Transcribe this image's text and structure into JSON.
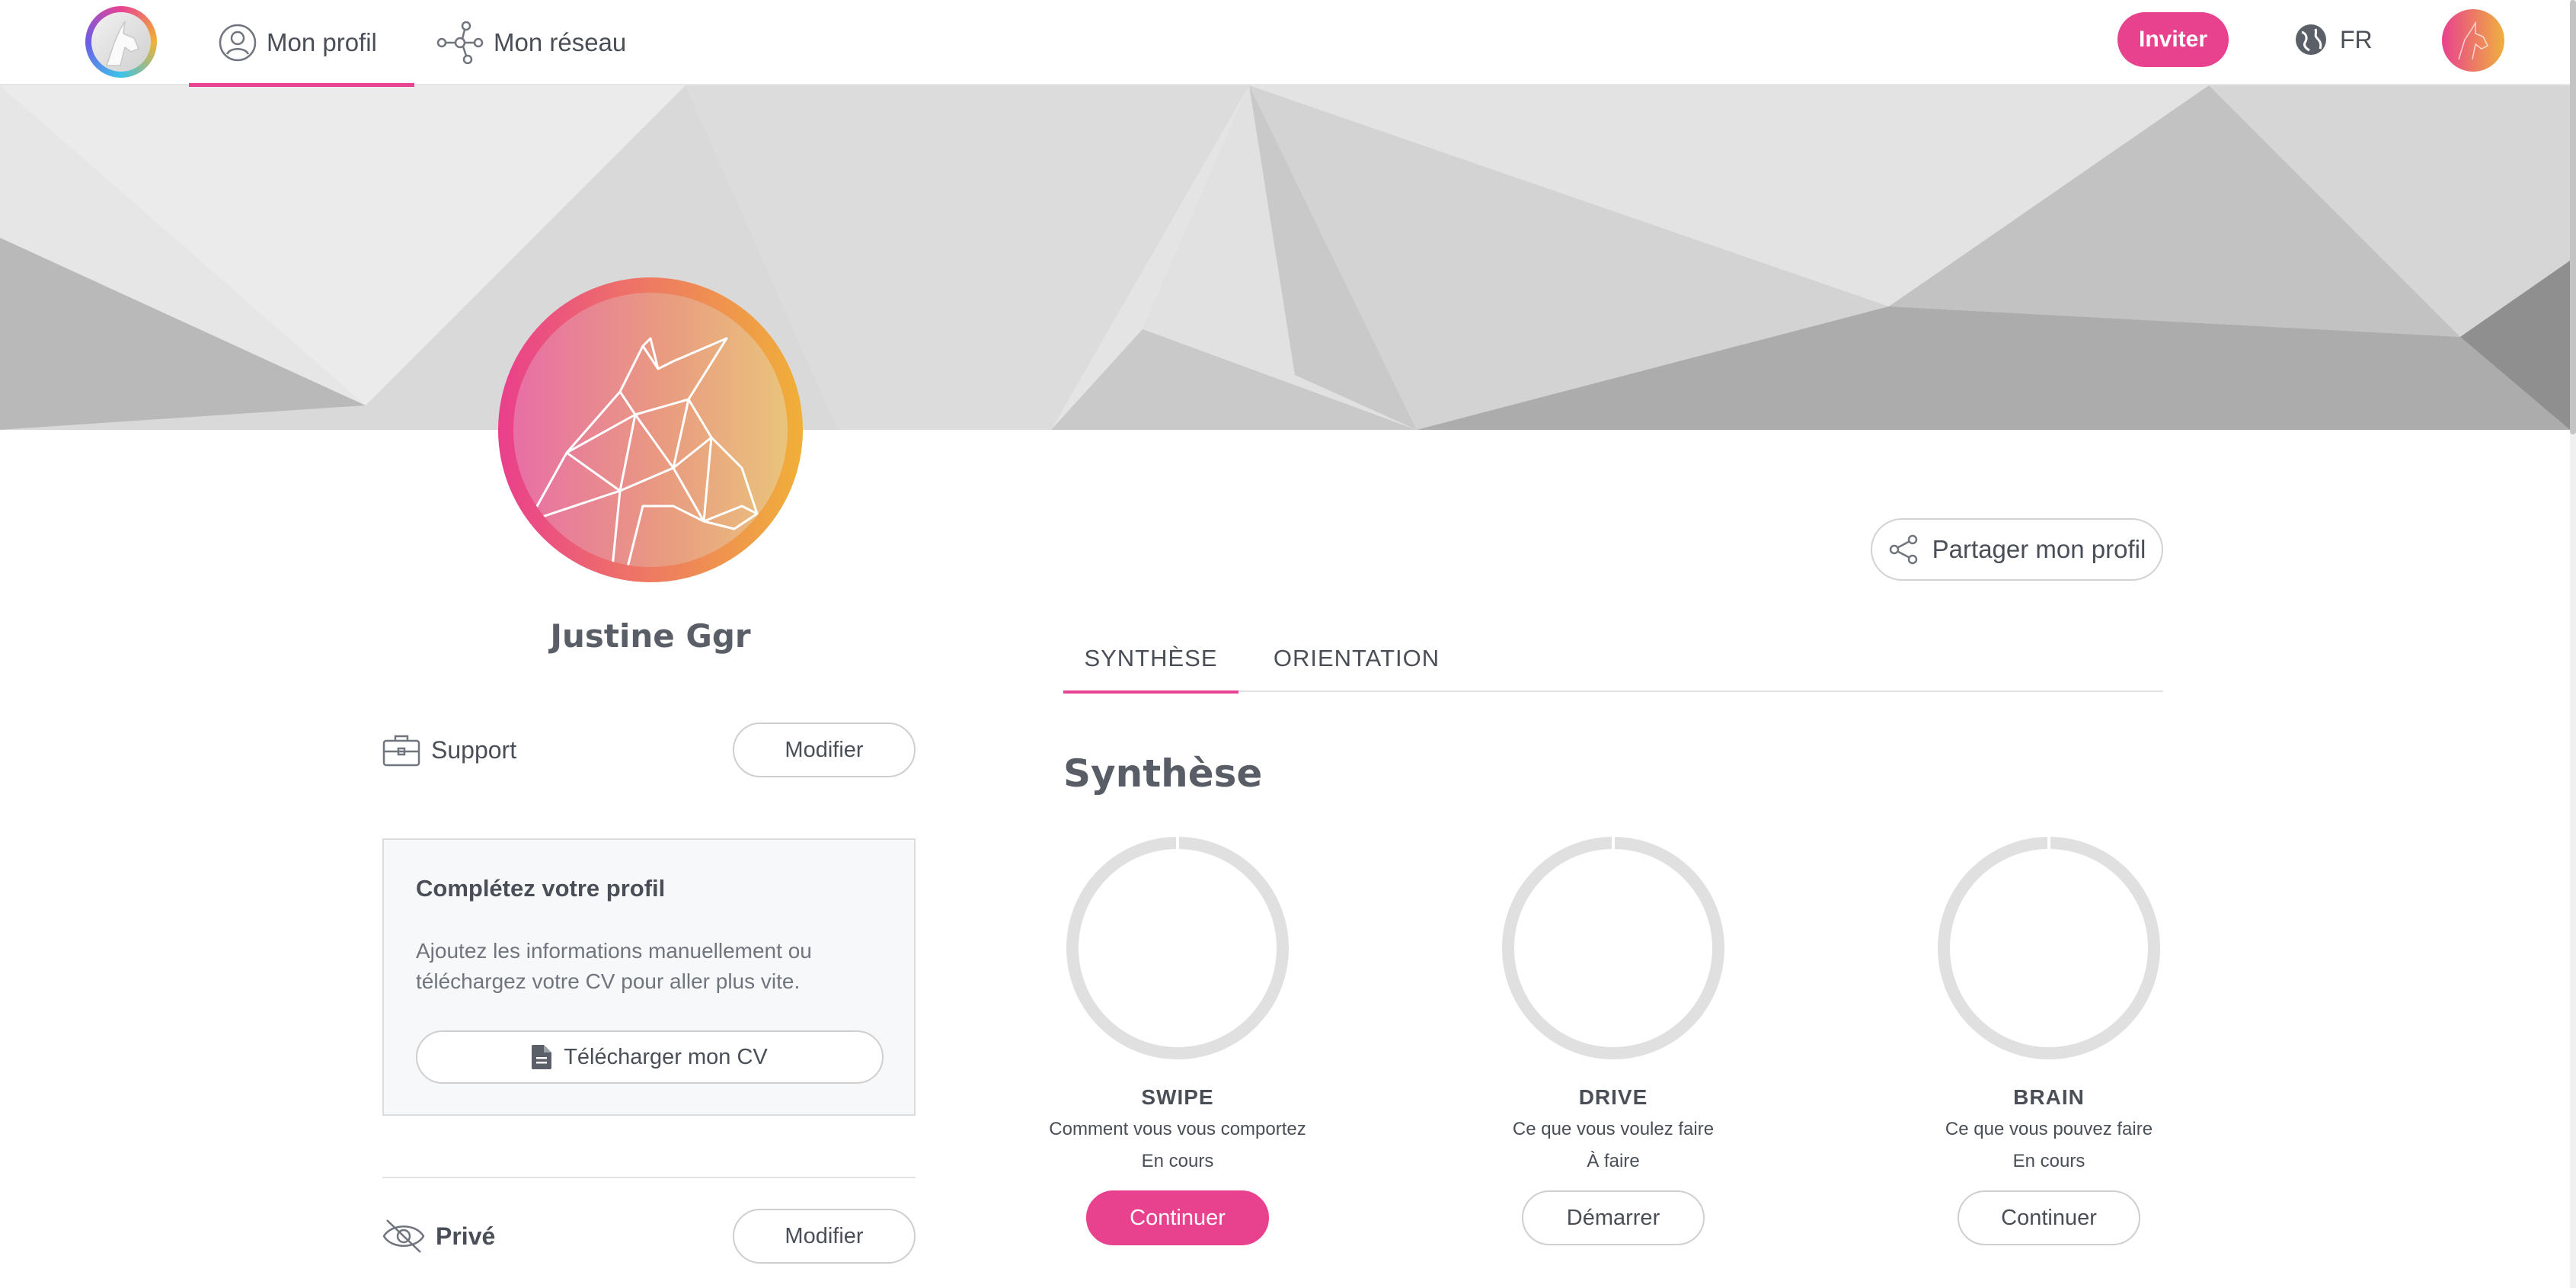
{
  "nav": {
    "profile_label": "Mon profil",
    "network_label": "Mon réseau",
    "invite_label": "Inviter",
    "language": "FR"
  },
  "profile": {
    "name": "Justine Ggr"
  },
  "left": {
    "support_label": "Support",
    "support_edit": "Modifier",
    "complete_title": "Complétez votre profil",
    "complete_text": "Ajoutez les informations manuellement ou téléchargez votre CV pour aller plus vite.",
    "cv_button": "Télécharger mon CV",
    "private_label": "Privé",
    "private_edit": "Modifier"
  },
  "right": {
    "share_label": "Partager mon profil",
    "tabs": [
      {
        "label": "SYNTHÈSE",
        "active": true
      },
      {
        "label": "ORIENTATION",
        "active": false
      }
    ],
    "section_title": "Synthèse",
    "tests": [
      {
        "name": "SWIPE",
        "description": "Comment vous vous comportez",
        "status": "En cours",
        "button": "Continuer",
        "primary": true,
        "progress": 0
      },
      {
        "name": "DRIVE",
        "description": "Ce que vous voulez faire",
        "status": "À faire",
        "button": "Démarrer",
        "primary": false,
        "progress": 0
      },
      {
        "name": "BRAIN",
        "description": "Ce que vous pouvez faire",
        "status": "En cours",
        "button": "Continuer",
        "primary": false,
        "progress": 0
      }
    ]
  },
  "colors": {
    "accent": "#e8418d",
    "ring": "#e0e0e0",
    "text": "#4a4f57"
  },
  "icons": {
    "logo": "unicorn-logo-icon",
    "profile": "user-icon",
    "network": "network-icon",
    "language": "globe-icon",
    "support": "briefcase-icon",
    "cv": "document-icon",
    "private": "eye-off-icon",
    "share": "share-icon"
  }
}
